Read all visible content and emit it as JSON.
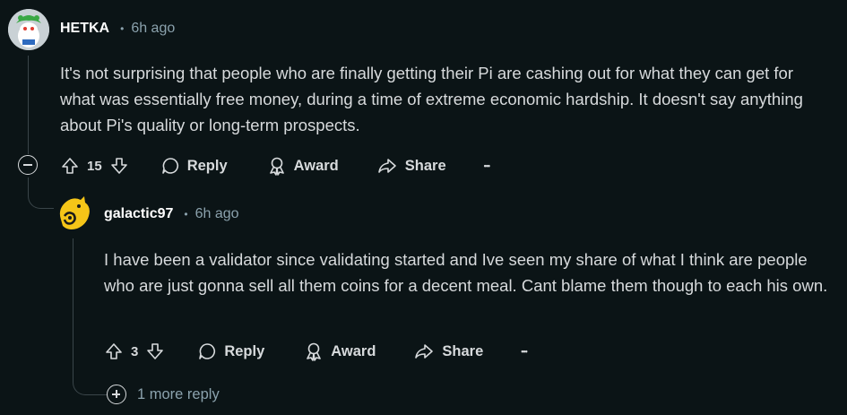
{
  "comments": [
    {
      "author": "HETKA",
      "separator": "•",
      "time": "6h ago",
      "body": "It's not surprising that people who are finally getting their Pi are cashing out for what they can get for what was essentially free money,  during a time of extreme economic hardship. It doesn't say anything about Pi's quality or long-term prospects.",
      "votes": "15",
      "reply_label": "Reply",
      "award_label": "Award",
      "share_label": "Share",
      "more_label": "•••"
    },
    {
      "author": "galactic97",
      "separator": "•",
      "time": "6h ago",
      "body": "I have been a validator since validating started and Ive seen my share of what I think are people who are just gonna sell all them coins for a decent meal. Cant blame them though to each his own.",
      "votes": "3",
      "reply_label": "Reply",
      "award_label": "Award",
      "share_label": "Share",
      "more_label": "•••"
    }
  ],
  "more_replies": "1 more reply",
  "colors": {
    "background": "#0b1416",
    "text": "#d7dadc",
    "muted": "#8ba2ad",
    "thread_line": "#3a4549",
    "avatar1_bg": "#d0d6d9",
    "avatar2_bg": "#f5c518"
  }
}
